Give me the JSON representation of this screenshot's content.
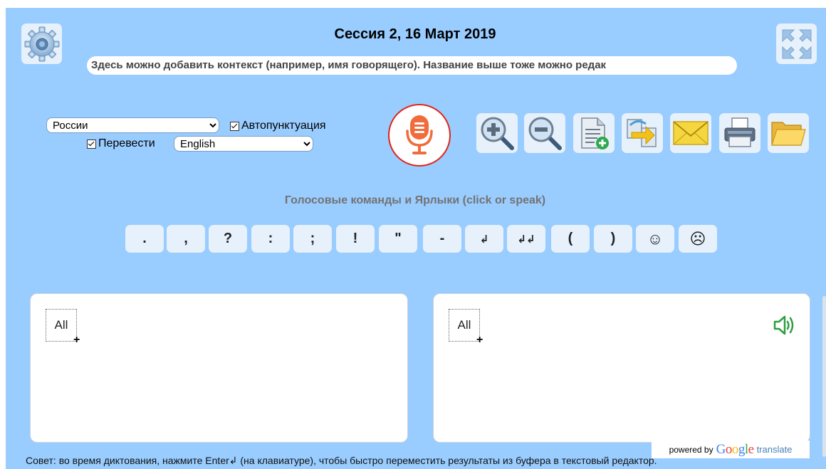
{
  "session": {
    "title": "Сессия 2, 16 Март 2019",
    "context_text": "Здесь можно добавить контекст (например, имя говорящего). Название выше тоже можно редак"
  },
  "settings": {
    "language_value": "России",
    "autopunctuation_label": "Автопунктуация",
    "autopunctuation_checked": true,
    "translate_label": "Перевести",
    "translate_checked": true,
    "translate_language_value": "English"
  },
  "toolbar": {
    "icons": [
      "settings-gear-icon",
      "fullscreen-icon",
      "microphone-icon",
      "zoom-in-icon",
      "zoom-out-icon",
      "new-document-icon",
      "export-icon",
      "email-icon",
      "print-icon",
      "folder-icon"
    ]
  },
  "commands": {
    "hint": "Голосовые команды и Ярлыки (click or speak)",
    "keys": [
      ".",
      ",",
      "?",
      ":",
      ";",
      "!",
      "\"",
      "-",
      "↲",
      "↲↲",
      "(",
      ")",
      "☺",
      "☹"
    ]
  },
  "editor": {
    "left_tag": "All",
    "right_tag": "All"
  },
  "footer": {
    "powered_by": "powered by",
    "google_letters": [
      "G",
      "o",
      "o",
      "g",
      "l",
      "e"
    ],
    "translate_word": "translate",
    "tip": "Совет: во время диктования, нажмите Enter↲ (на клавиатуре), чтобы быстро переместить результаты из буфера в текстовый редактор."
  },
  "colors": {
    "background": "#99ccff",
    "button_bg": "#e6f1fb",
    "mic_ring": "#e2231a",
    "mic_icon": "#f26b3a",
    "speaker": "#2e9e3e"
  }
}
